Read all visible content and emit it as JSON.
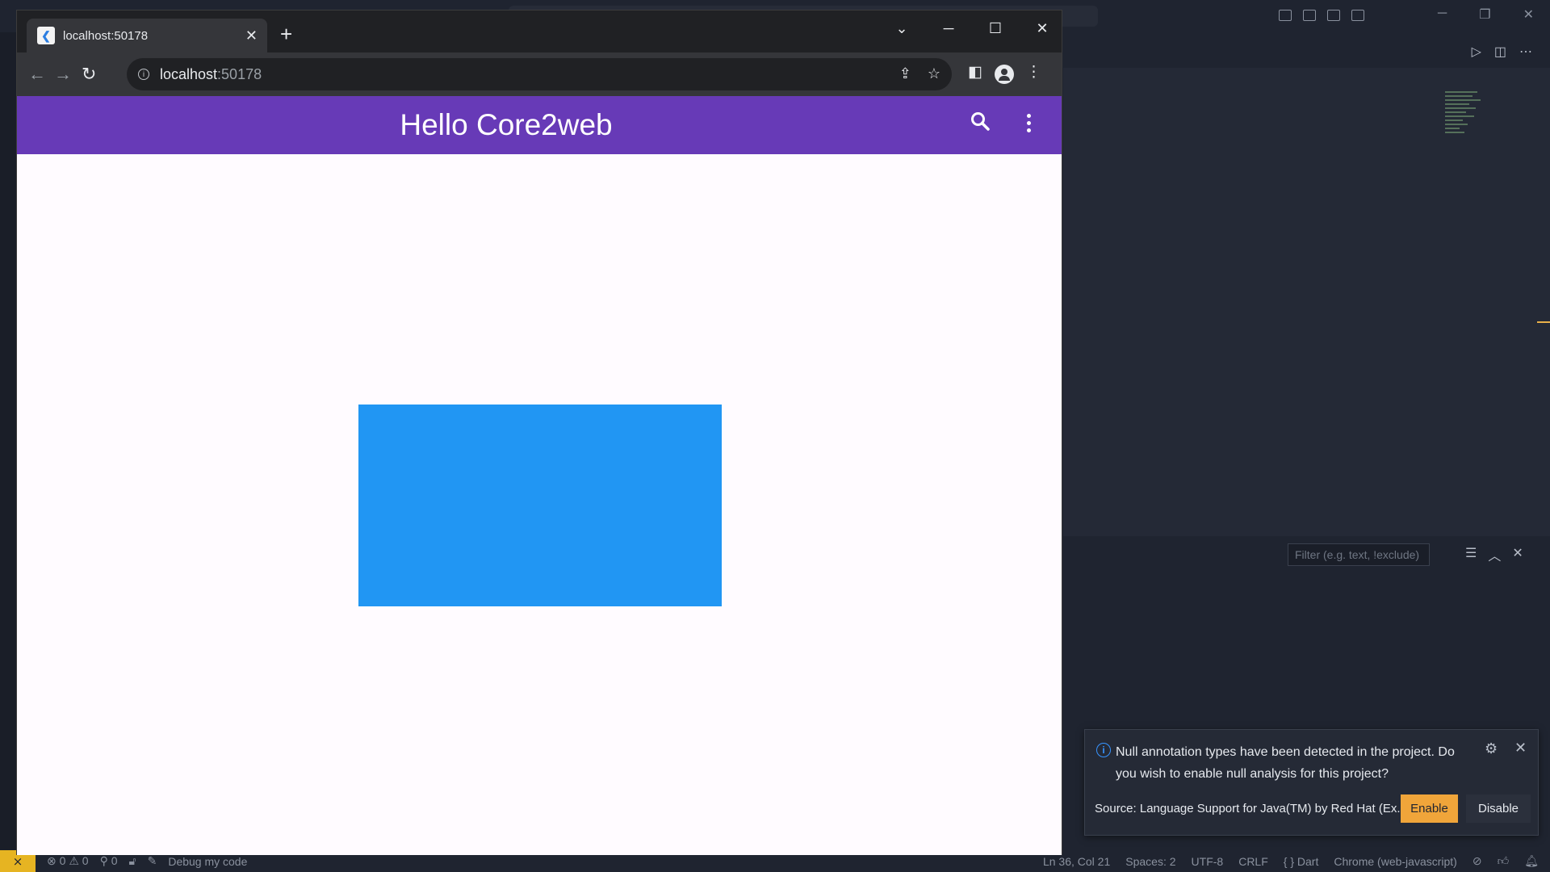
{
  "browser": {
    "tab_title": "localhost:50178",
    "url_host": "localhost",
    "url_port": ":50178"
  },
  "app": {
    "title": "Hello Core2web",
    "appbar_color": "#673ab7",
    "box_color": "#2196f3"
  },
  "vscode": {
    "filter_placeholder": "Filter (e.g. text, !exclude)",
    "status": {
      "errors": "0",
      "warnings": "0",
      "ports": "0",
      "debug_label": "Debug my code",
      "position": "Ln 36, Col 21",
      "spaces": "Spaces: 2",
      "encoding": "UTF-8",
      "eol": "CRLF",
      "language": "Dart",
      "device": "Chrome (web-javascript)"
    }
  },
  "notification": {
    "message": "Null annotation types have been detected in the project. Do you wish to enable null analysis for this project?",
    "source": "Source: Language Support for Java(TM) by Red Hat (Ex...",
    "enable_label": "Enable",
    "disable_label": "Disable"
  }
}
